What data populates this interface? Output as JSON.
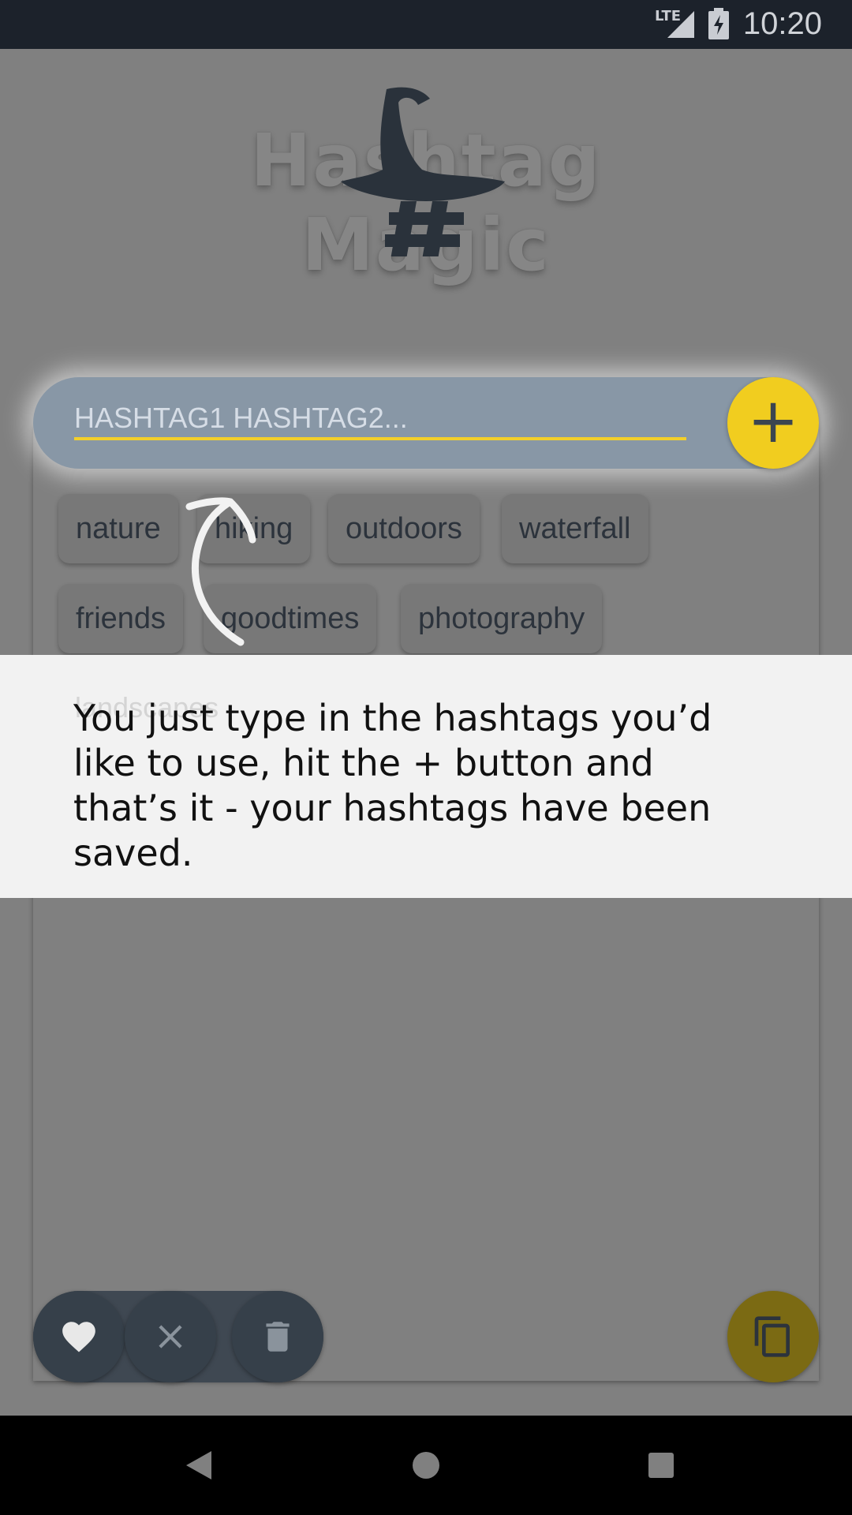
{
  "status_bar": {
    "network": "LTE",
    "time": "10:20",
    "icons": [
      "signal-icon",
      "battery-charging-icon"
    ]
  },
  "app": {
    "logo_text": "Hashtag Magic",
    "logo_icon": "wizard-hat-hashtag-icon"
  },
  "input": {
    "placeholder": "HASHTAG1 HASHTAG2...",
    "add_icon": "plus-icon",
    "accent_color": "#f1cd1f"
  },
  "hashtags": [
    {
      "label": "nature"
    },
    {
      "label": "hiking"
    },
    {
      "label": "outdoors"
    },
    {
      "label": "waterfall"
    },
    {
      "label": "friends"
    },
    {
      "label": "goodtimes"
    },
    {
      "label": "photography"
    },
    {
      "label": "landscapes"
    }
  ],
  "tutorial": {
    "text": "You just type in the hashtags you’d like to use, hit the + button and that’s it - your hashtags have been saved."
  },
  "actions": {
    "favorite_icon": "heart-icon",
    "clear_icon": "close-icon",
    "delete_icon": "trash-icon",
    "copy_icon": "copy-icon"
  },
  "navigation": [
    "back-icon",
    "home-icon",
    "recents-icon"
  ]
}
